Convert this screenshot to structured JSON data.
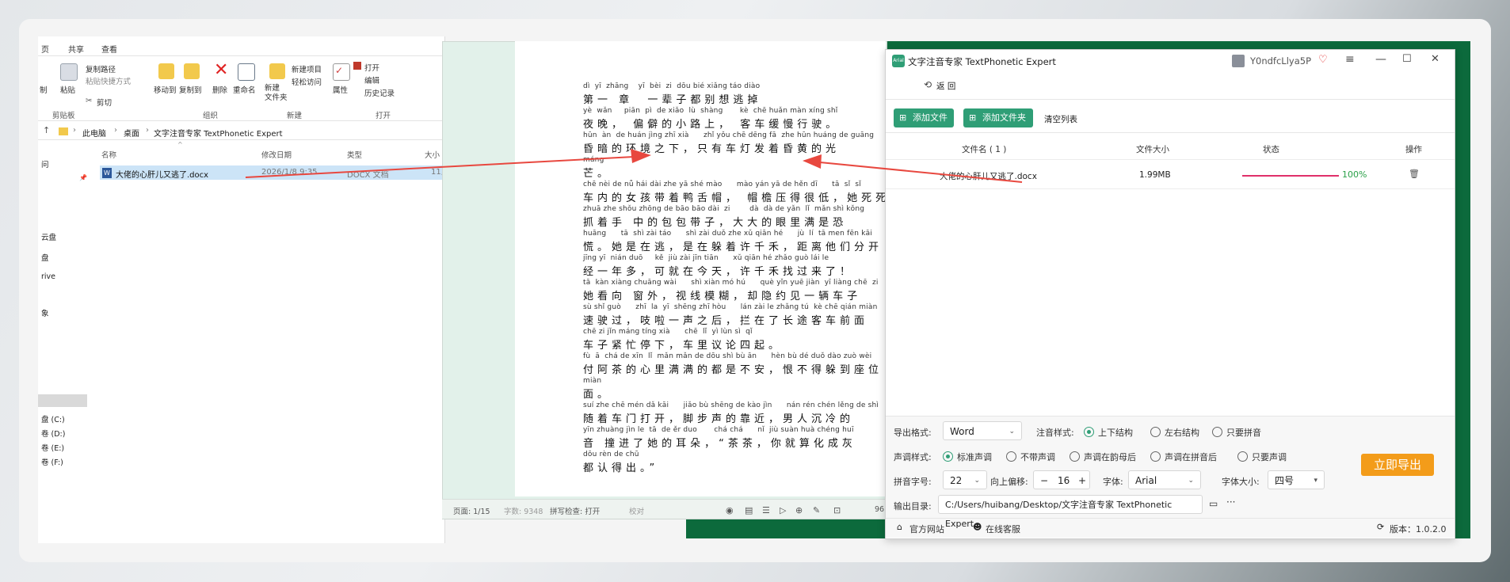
{
  "explorer": {
    "tabs": [
      "页",
      "共享",
      "查看"
    ],
    "ribbon": {
      "pin": "制",
      "paste": "粘贴",
      "copy_path": "复制路径",
      "paste_shortcut": "粘贴快捷方式",
      "cut": "剪切",
      "move_to": "移动到",
      "copy_to": "复制到",
      "delete": "删除",
      "rename": "重命名",
      "new_folder": "新建\n文件夹",
      "new_item": "新建项目",
      "easy_access": "轻松访问",
      "properties": "属性",
      "open": "打开",
      "edit": "编辑",
      "history": "历史记录",
      "group_clipboard": "剪贴板",
      "group_organize": "组织",
      "group_new": "新建",
      "group_open": "打开"
    },
    "breadcrumb": [
      "此电脑",
      "桌面",
      "文字注音专家 TextPhonetic Expert"
    ],
    "columns": [
      "名称",
      "修改日期",
      "类型",
      "大小"
    ],
    "file": {
      "name": "大佬的心肝儿又逃了.docx",
      "date": "2026/1/8 9:35",
      "type": "DOCX 文档",
      "size": "11,"
    },
    "sidebar": [
      "问",
      "云盘",
      "盘",
      "rive",
      "象",
      "盘 (C:)",
      "卷 (D:)",
      "卷 (E:)",
      "卷 (F:)"
    ]
  },
  "word": {
    "lines": [
      {
        "py": "dì  yī  zhāng    yī  bèi  zi  dōu bié xiǎng táo diào",
        "hz": "第一 章  一辈子都别想逃掉"
      },
      {
        "py": "yè  wǎn     piān  pì  de xiǎo  lù  shàng       kè  chē huǎn màn xíng shǐ",
        "hz": "夜晚， 偏僻的小路上， 客车缓慢行驶。"
      },
      {
        "py": "hūn  àn  de huán jìng zhī xià      zhǐ yǒu chē dēng fā  zhe hūn huáng de guāng",
        "hz": "昏暗的环境之下，只有车灯发着昏黄的光"
      },
      {
        "py": "máng",
        "hz": "芒。"
      },
      {
        "py": "chē nèi de nǚ hái dài zhe yā shé mào      mào yán yā de hěn dī      tā  sǐ  sǐ",
        "hz": "车内的女孩带着鸭舌帽， 帽檐压得很低，她死死"
      },
      {
        "py": "zhuā zhe shǒu zhōng de bāo bāo dài  zi        dà  dà de yǎn  lǐ  mǎn shì kǒng",
        "hz": "抓着手 中的包包带子，大大的眼里满是恐"
      },
      {
        "py": "huāng      tā  shì zài táo      shì zài duǒ zhe xǔ qiān hé      jù  lí  tā men fēn kāi",
        "hz": "慌。她是在逃，是在躲着许千禾，距离他们分开"
      },
      {
        "py": "jīng yī  nián duō     kě  jiù zài jīn tiān      xǔ qiān hé zhǎo guò lái le",
        "hz": "经一年多，可就在今天，许千禾找过来了！"
      },
      {
        "py": "tā  kàn xiàng chuāng wài      shì xiàn mó hú      què yǐn yuē jiàn  yī liàng chē  zi",
        "hz": "她看向 窗外，视线模糊，却隐约见一辆车子"
      },
      {
        "py": "sù shǐ guò      zhī  la  yī  shēng zhī hòu      lán zài le zhǎng tú  kè chē qián miàn",
        "hz": "速驶过，吱啦一声之后，拦在了长途客车前面"
      },
      {
        "py": "chē zi jǐn máng tíng xià      chē  lǐ  yì lùn sì  qǐ",
        "hz": "车子紧忙停下，车里议论四起。"
      },
      {
        "py": "fù  ā  chá de xīn  lǐ  mǎn mǎn de dōu shì bù ān      hèn bù dé duǒ dào zuò wèi",
        "hz": "付阿茶的心里满满的都是不安，恨不得躲到座位"
      },
      {
        "py": "miàn",
        "hz": "面。"
      },
      {
        "py": "suí zhe chē mén dǎ kāi      jiǎo bù shēng de kào jìn      nán rén chén lěng de shì",
        "hz": "随着车门打开，脚步声的靠近，男人沉冷的"
      },
      {
        "py": "yīn zhuàng jìn le  tā  de ěr duo       chá chá      nǐ  jiù suàn huà chéng huī",
        "hz": "音 撞进了她的耳朵，“茶茶，你就算化成灰"
      },
      {
        "py": "dōu rèn de chū",
        "hz": "都认得出。”"
      }
    ],
    "status": {
      "page": "页面: 1/15",
      "words": "字数: 9348",
      "spell": "拼写检查: 打开",
      "proof": "校对",
      "zoom": "96"
    }
  },
  "app": {
    "title": "文字注音专家 TextPhonetic Expert",
    "user": "Y0ndfcLlya5P",
    "back": "返 回",
    "add_file": "添加文件",
    "add_folder": "添加文件夹",
    "clear": "清空列表",
    "table": {
      "headers": [
        "文件名 ( 1 )",
        "文件大小",
        "状态",
        "操作"
      ],
      "rows": [
        {
          "name": "大佬的心肝儿又逃了.docx",
          "size": "1.99MB",
          "progress": 100,
          "progress_label": "100%"
        }
      ]
    },
    "options": {
      "export_format_label": "导出格式:",
      "export_format": "Word",
      "phonetic_style_label": "注音样式:",
      "phonetic_styles": [
        "上下结构",
        "左右结构",
        "只要拼音"
      ],
      "phonetic_selected": 0,
      "tone_style_label": "声调样式:",
      "tone_styles": [
        "标准声调",
        "不带声调",
        "声调在韵母后",
        "声调在拼音后",
        "只要声调"
      ],
      "tone_selected": 0,
      "pinyin_size_label": "拼音字号:",
      "pinyin_size": "22",
      "offset_label": "向上偏移:",
      "offset_value": "16",
      "font_label": "字体:",
      "font": "Arial",
      "font_size_label": "字体大小:",
      "font_size": "四号",
      "output_dir_label": "输出目录:",
      "output_dir": "C:/Users/huibang/Desktop/文字注音专家 TextPhonetic Expert",
      "export_button": "立即导出"
    },
    "footer": {
      "website": "官方网站",
      "support": "在线客服",
      "version": "版本：1.0.2.0"
    }
  },
  "colors": {
    "accent_green": "#2f9e76",
    "progress": "#e0306a",
    "progress_text": "#2aa048",
    "export": "#f39c1a",
    "arrow": "#e8483f"
  }
}
